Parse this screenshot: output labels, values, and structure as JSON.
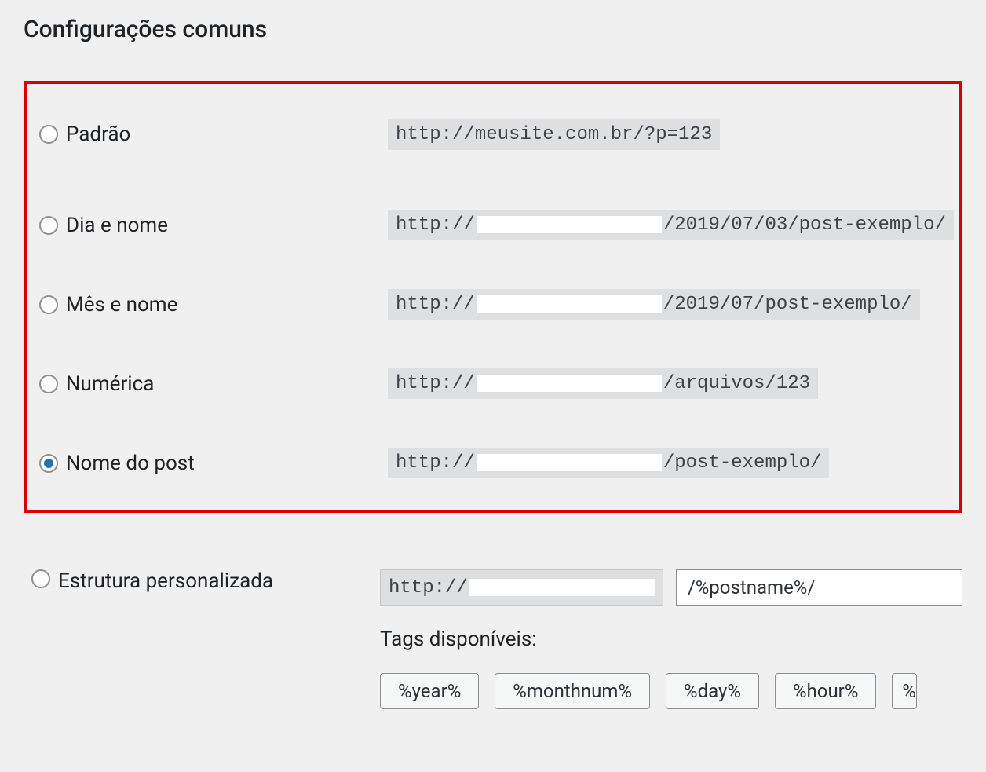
{
  "section_title": "Configurações comuns",
  "options": [
    {
      "id": "default",
      "label": "Padrão",
      "example_before": "http://meusite.com.br/?p=123",
      "example_after": "",
      "has_gap": false,
      "checked": false
    },
    {
      "id": "day-name",
      "label": "Dia e nome",
      "example_before": "http://",
      "example_after": "/2019/07/03/post-exemplo/",
      "has_gap": true,
      "checked": false
    },
    {
      "id": "month-name",
      "label": "Mês e nome",
      "example_before": "http://",
      "example_after": "/2019/07/post-exemplo/",
      "has_gap": true,
      "checked": false
    },
    {
      "id": "numeric",
      "label": "Numérica",
      "example_before": "http://",
      "example_after": "/arquivos/123",
      "has_gap": true,
      "checked": false
    },
    {
      "id": "post-name",
      "label": "Nome do post",
      "example_before": "http://",
      "example_after": "/post-exemplo/",
      "has_gap": true,
      "checked": true
    }
  ],
  "custom": {
    "label": "Estrutura personalizada",
    "prefix": "http://",
    "value": "/%postname%/",
    "checked": false
  },
  "tags": {
    "label": "Tags disponíveis:",
    "items": [
      "%year%",
      "%monthnum%",
      "%day%",
      "%hour%"
    ],
    "partial": "%"
  }
}
